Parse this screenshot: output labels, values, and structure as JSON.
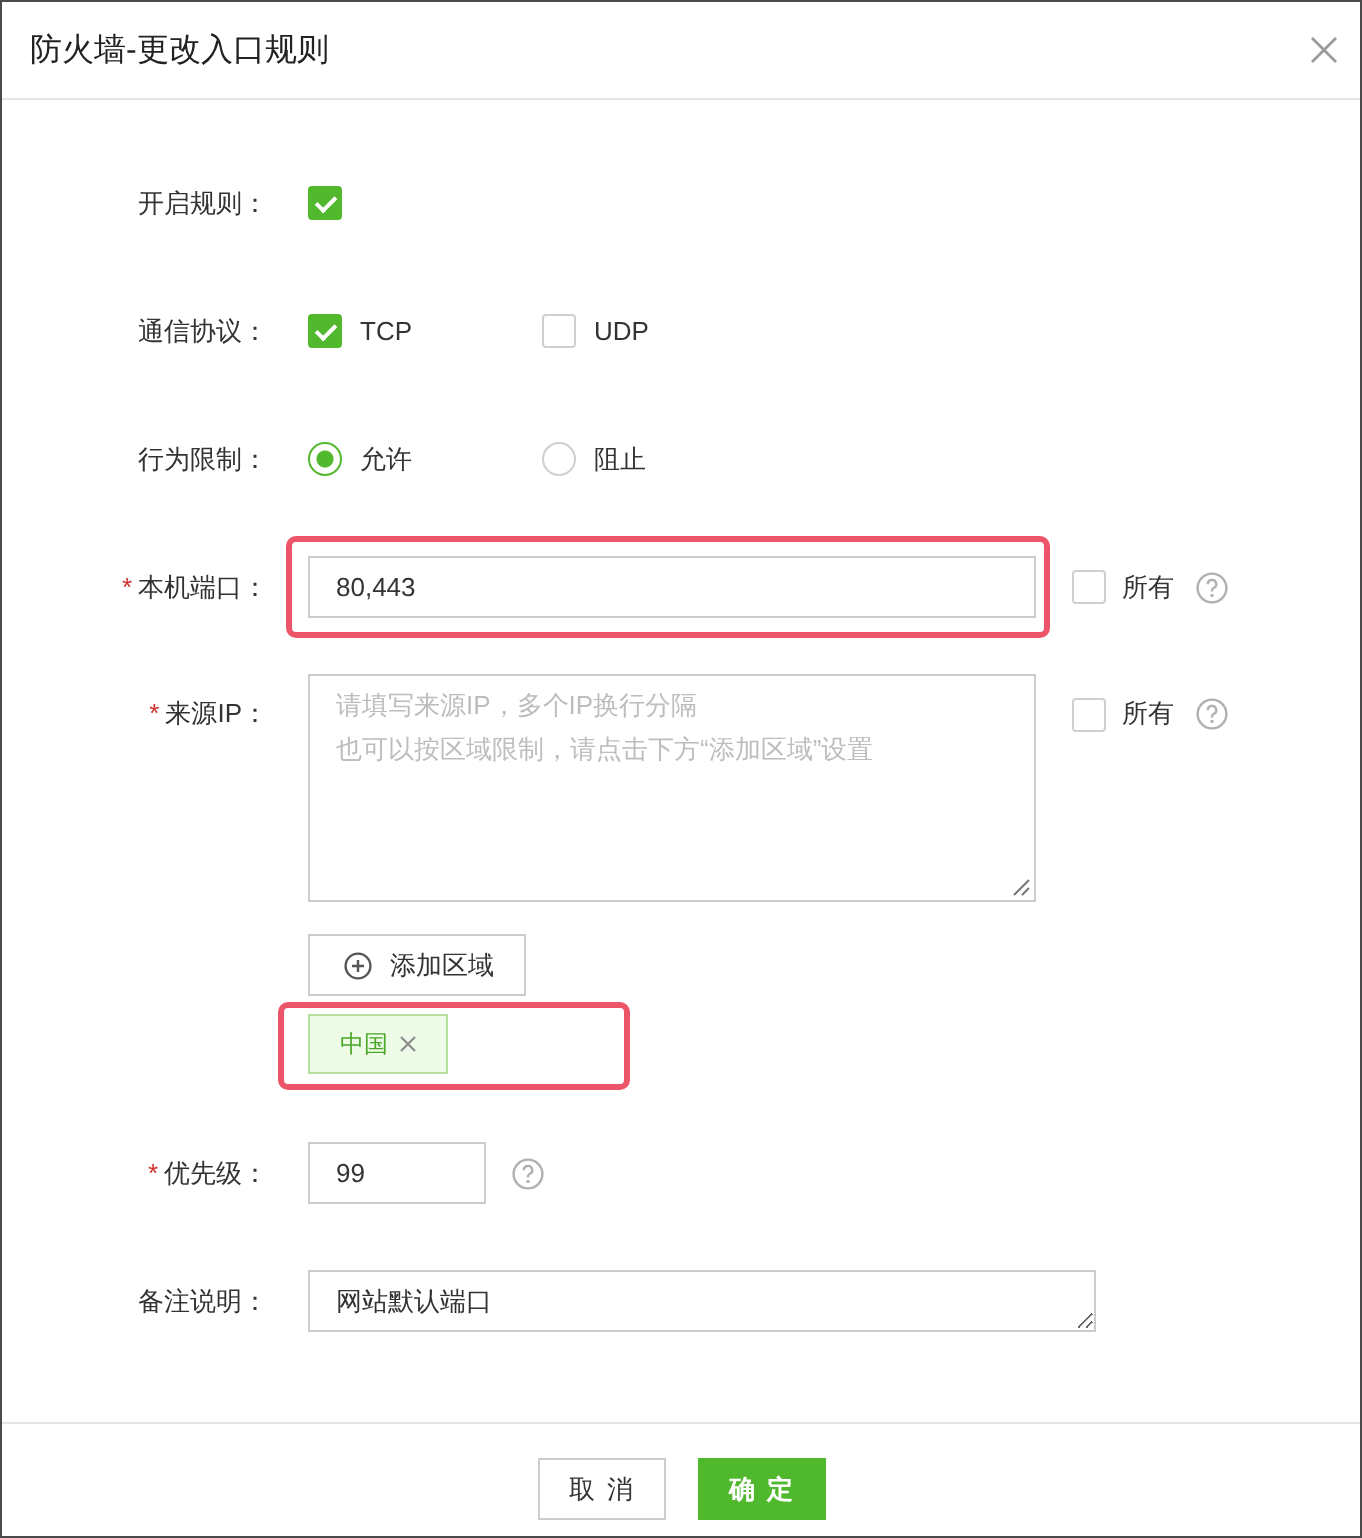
{
  "dialog": {
    "title": "防火墙-更改入口规则"
  },
  "fields": [
    {
      "kind": "checkbox",
      "label": "开启规则：",
      "checked": true
    },
    {
      "kind": "checkbox-group",
      "label": "通信协议：",
      "options": [
        {
          "label": "TCP",
          "checked": true
        },
        {
          "label": "UDP",
          "checked": false
        }
      ]
    },
    {
      "kind": "radio-group",
      "label": "行为限制：",
      "options": [
        {
          "label": "允许",
          "selected": true
        },
        {
          "label": "阻止",
          "selected": false
        }
      ]
    },
    {
      "kind": "text",
      "required_mark": "*",
      "label": "本机端口：",
      "value": "80,443",
      "highlighted": true,
      "all": {
        "label": "所有",
        "checked": false
      },
      "help": true
    },
    {
      "kind": "textarea",
      "required_mark": "*",
      "label": "来源IP：",
      "placeholder_lines": [
        "请填写来源IP，多个IP换行分隔",
        "也可以按区域限制，请点击下方“添加区域”设置"
      ],
      "all": {
        "label": "所有",
        "checked": false
      },
      "help": true,
      "regions": {
        "button": "添加区域",
        "highlighted": true,
        "tags": [
          {
            "label": "中国"
          }
        ]
      }
    },
    {
      "kind": "number",
      "required_mark": "*",
      "label": "优先级：",
      "value": "99",
      "help": true
    },
    {
      "kind": "note",
      "label": "备注说明：",
      "value": "网站默认端口"
    }
  ],
  "footer": {
    "buttons": [
      {
        "label": "取消",
        "kind": "default"
      },
      {
        "label": "确定",
        "kind": "primary"
      }
    ]
  }
}
